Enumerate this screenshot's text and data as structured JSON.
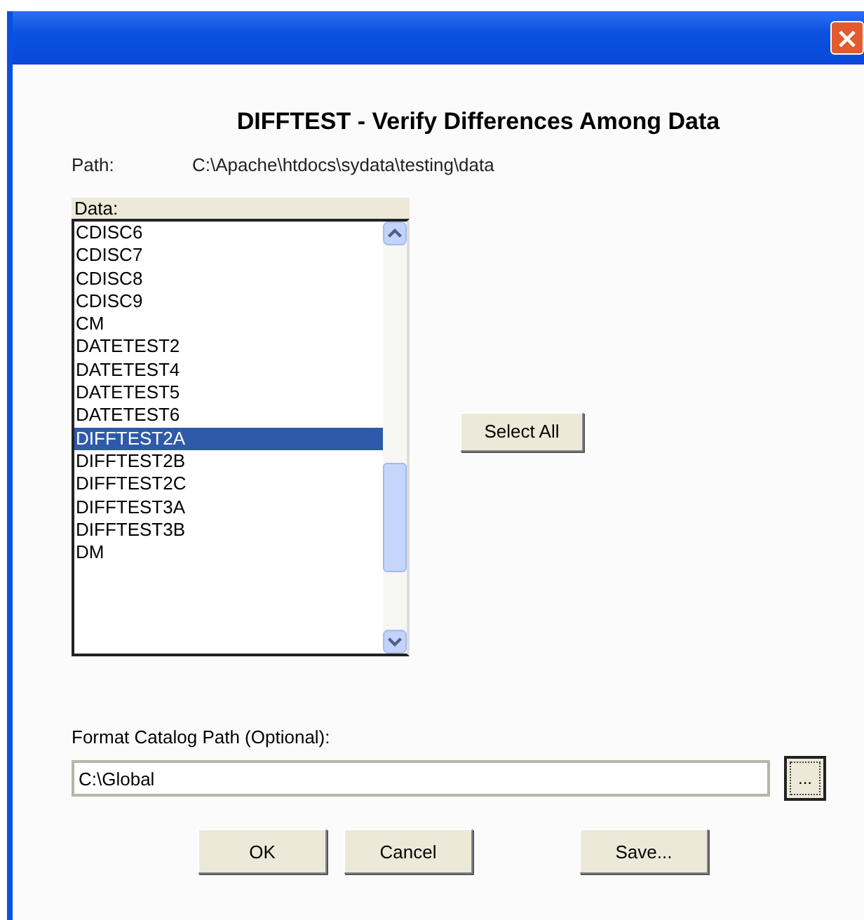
{
  "window": {
    "title": "DIFFTEST - Verify Differences Among Data",
    "close": "×"
  },
  "path": {
    "label": "Path:",
    "value": "C:\\Apache\\htdocs\\sydata\\testing\\data"
  },
  "data_list": {
    "label": "Data:",
    "items": [
      {
        "text": "CDISC6",
        "selected": false
      },
      {
        "text": "CDISC7",
        "selected": false
      },
      {
        "text": "CDISC8",
        "selected": false
      },
      {
        "text": "CDISC9",
        "selected": false
      },
      {
        "text": "CM",
        "selected": false
      },
      {
        "text": "DATETEST2",
        "selected": false
      },
      {
        "text": "DATETEST4",
        "selected": false
      },
      {
        "text": "DATETEST5",
        "selected": false
      },
      {
        "text": "DATETEST6",
        "selected": false
      },
      {
        "text": "DIFFTEST2A",
        "selected": true
      },
      {
        "text": "DIFFTEST2B",
        "selected": false
      },
      {
        "text": "DIFFTEST2C",
        "selected": false
      },
      {
        "text": "DIFFTEST3A",
        "selected": false
      },
      {
        "text": "DIFFTEST3B",
        "selected": false
      },
      {
        "text": "DM",
        "selected": false
      }
    ]
  },
  "select_all": "Select All",
  "format_catalog": {
    "label": "Format Catalog Path (Optional):",
    "value": "C:\\Global",
    "browse": "..."
  },
  "buttons": [
    "OK",
    "Cancel",
    "Save..."
  ]
}
